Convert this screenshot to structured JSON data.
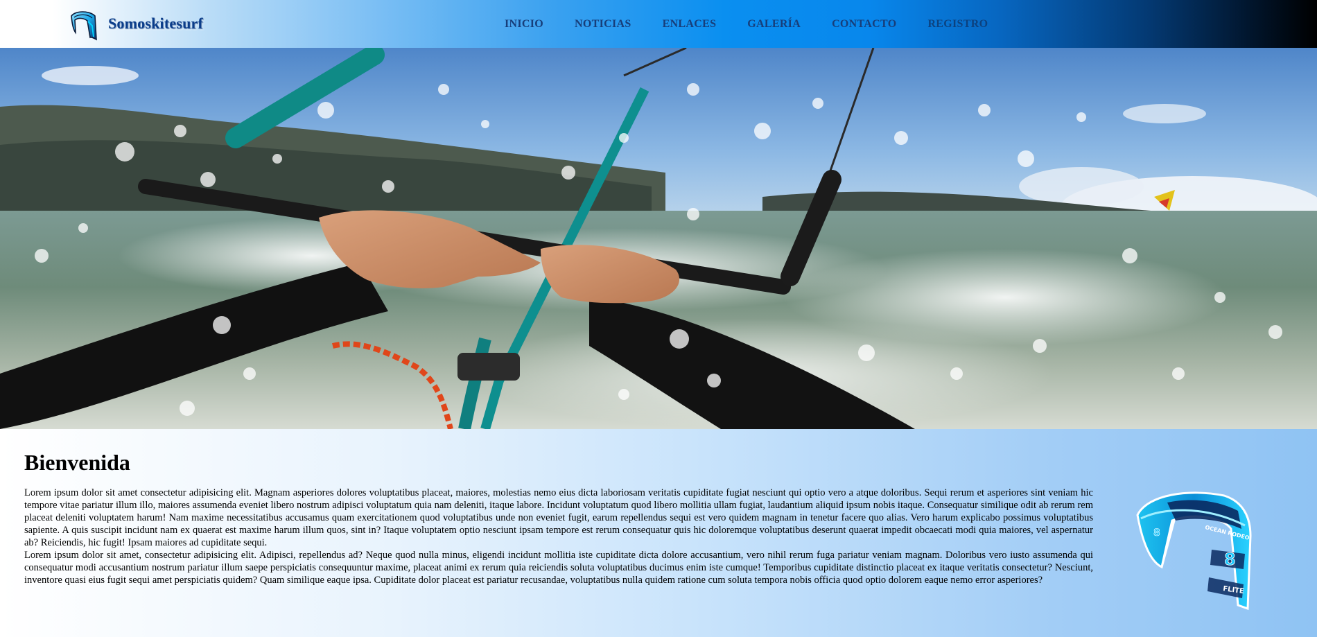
{
  "header": {
    "brand_name": "Somoskitesurf",
    "logo_icon": "kite-logo-icon",
    "nav": [
      {
        "label": "INICIO"
      },
      {
        "label": "NOTICIAS"
      },
      {
        "label": "ENLACES"
      },
      {
        "label": "GALERÍA"
      },
      {
        "label": "CONTACTO"
      },
      {
        "label": "REGISTRO"
      }
    ]
  },
  "hero": {
    "image": "kitesurf-hands-on-bar-photo"
  },
  "main": {
    "title": "Bienvenida",
    "paragraphs": [
      "Lorem ipsum dolor sit amet consectetur adipisicing elit. Magnam asperiores dolores voluptatibus placeat, maiores, molestias nemo eius dicta laboriosam veritatis cupiditate fugiat nesciunt qui optio vero a atque doloribus. Sequi rerum et asperiores sint veniam hic tempore vitae pariatur illum illo, maiores assumenda eveniet libero nostrum adipisci voluptatum quia nam deleniti, itaque labore. Incidunt voluptatum quod libero mollitia ullam fugiat, laudantium aliquid ipsum nobis itaque. Consequatur similique odit ab rerum rem placeat deleniti voluptatem harum! Nam maxime necessitatibus accusamus quam exercitationem quod voluptatibus unde non eveniet fugit, earum repellendus sequi est vero quidem magnam in tenetur facere quo alias. Vero harum explicabo possimus voluptatibus sapiente. A quis suscipit incidunt nam ex quaerat est maxime harum illum quos, sint in? Itaque voluptatem optio nesciunt ipsam tempore est rerum consequatur quis hic doloremque voluptatibus deserunt quaerat impedit obcaecati modi quia maiores, vel aspernatur ab? Reiciendis, hic fugit! Ipsam maiores ad cupiditate sequi.",
      "Lorem ipsum dolor sit amet, consectetur adipisicing elit. Adipisci, repellendus ad? Neque quod nulla minus, eligendi incidunt mollitia iste cupiditate dicta dolore accusantium, vero nihil rerum fuga pariatur veniam magnam. Doloribus vero iusto assumenda qui consequatur modi accusantium nostrum pariatur illum saepe perspiciatis consequuntur maxime, placeat animi ex rerum quia reiciendis soluta voluptatibus ducimus enim iste cumque! Temporibus cupiditate distinctio placeat ex itaque veritatis consectetur? Nesciunt, inventore quasi eius fugit sequi amet perspiciatis quidem? Quam similique eaque ipsa. Cupiditate dolor placeat est pariatur recusandae, voluptatibus nulla quidem ratione cum soluta tempora nobis officia quod optio dolorem eaque nemo error asperiores?"
    ],
    "side_image": "kite-product-image",
    "kite_labels": {
      "model": "OCEAN RODEO",
      "size": "8",
      "name": "FLITE"
    }
  },
  "colors": {
    "nav_text": "#173e7a",
    "brand_text": "#0b3d8a",
    "header_gradient_mid": "#0a8ff0",
    "header_gradient_end": "#000000"
  }
}
